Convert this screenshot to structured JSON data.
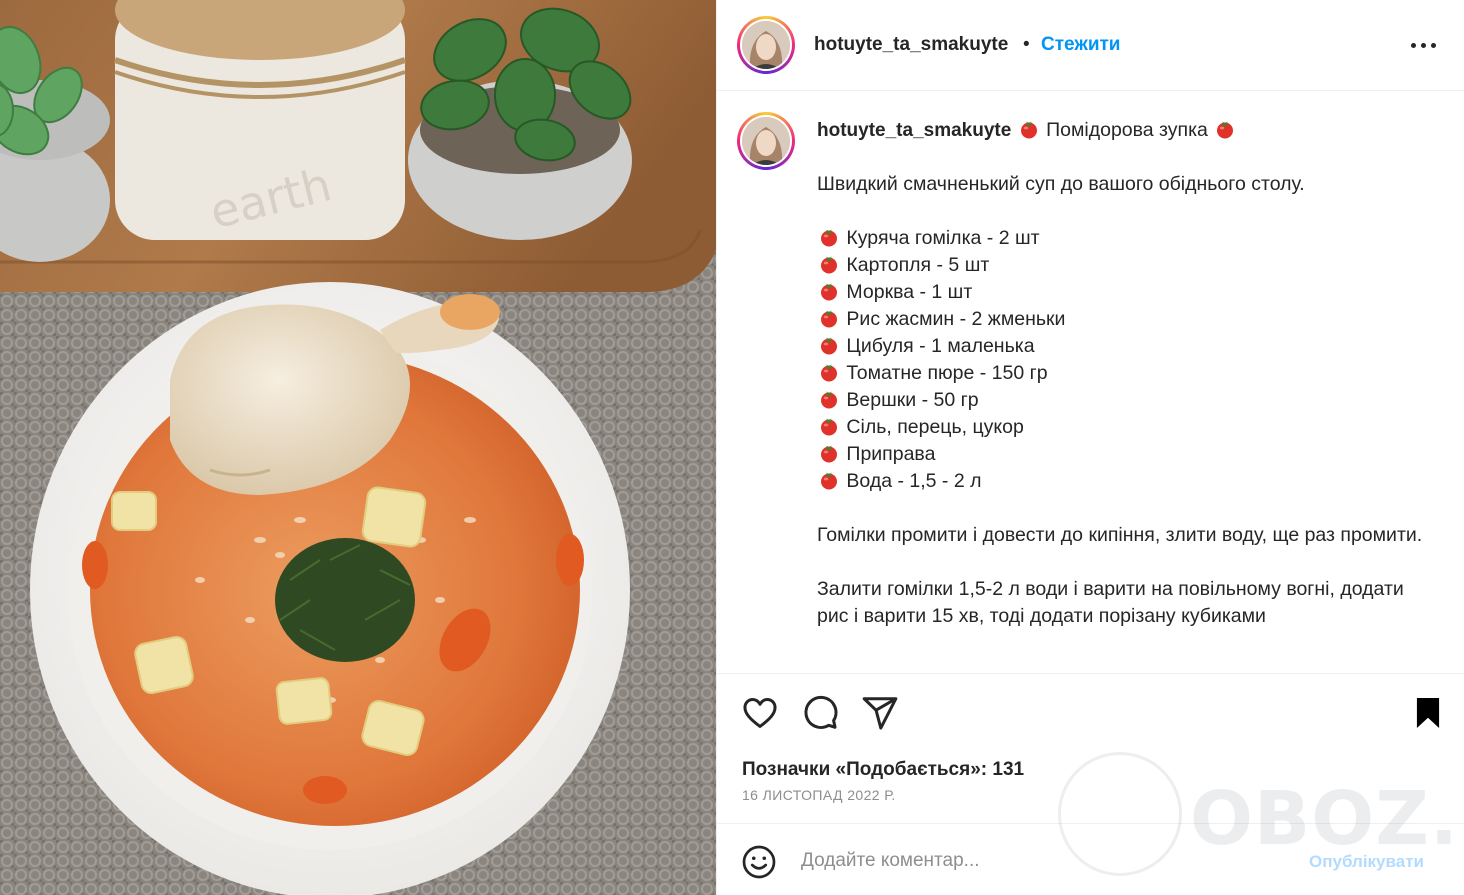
{
  "post": {
    "username": "hotuyte_ta_smakuyte",
    "follow_label": "Стежити",
    "separator": "•"
  },
  "caption": {
    "title": "Помідорова зупка",
    "intro": "Швидкий смачненький суп до вашого обіднього столу.",
    "ingredients": [
      "Куряча гомілка - 2 шт",
      "Картопля - 5 шт",
      "Морква - 1 шт",
      "Рис жасмин - 2 жменьки",
      "Цибуля - 1 маленька",
      "Томатне пюре - 150 гр",
      "Вершки - 50 гр",
      "Сіль, перець, цукор",
      "Приправа",
      "Вода - 1,5 - 2 л"
    ],
    "step1": "Гомілки промити і довести до кипіння, злити воду, ще раз промити.",
    "step2": "Залити гомілки 1,5-2 л води і варити на повільному вогні, додати рис і варити 15 хв, тоді додати порізану кубиками"
  },
  "engagement": {
    "likes_text": "Позначки «Подобається»: 131",
    "date": "16 ЛИСТОПАД 2022 Р."
  },
  "comment": {
    "placeholder": "Додайте коментар...",
    "publish_label": "Опублікувати"
  },
  "watermark": {
    "text": "OBOZ.UA"
  },
  "colors": {
    "link": "#0095f6",
    "publish_disabled": "#b3dbff",
    "muted": "#8e8e8e",
    "text": "#262626"
  },
  "icons": [
    "more-options-icon",
    "tomato-icon",
    "heart-icon",
    "comment-icon",
    "share-icon",
    "bookmark-icon",
    "emoji-icon"
  ]
}
